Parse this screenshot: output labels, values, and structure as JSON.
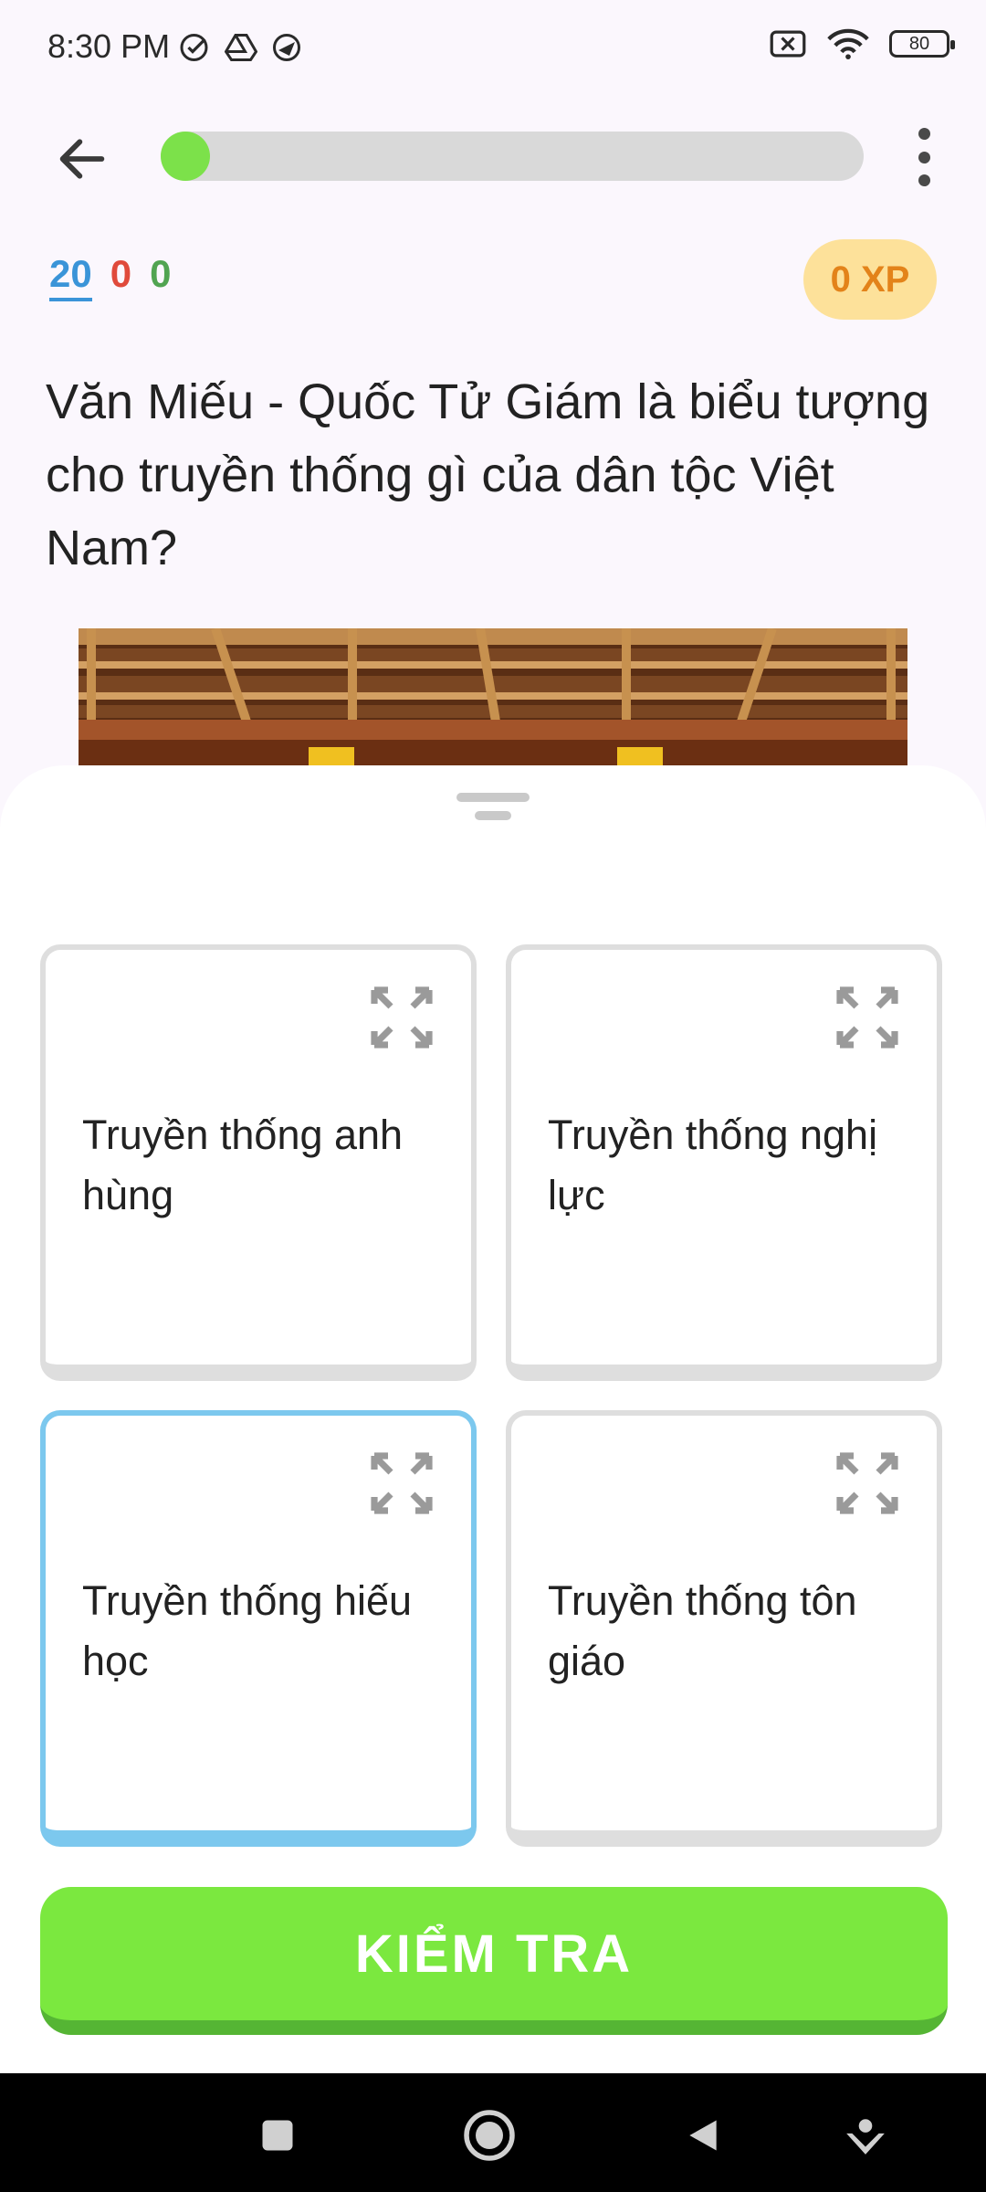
{
  "status_bar": {
    "time": "8:30 PM",
    "battery": "80",
    "left_icons": [
      "check-circle-icon",
      "drive-icon",
      "chat-icon"
    ],
    "right_icons": [
      "no-sim-icon",
      "wifi-icon",
      "battery-icon"
    ]
  },
  "top_bar": {
    "back_icon": "arrow-left-icon",
    "progress": 0.04,
    "progress_color": "#7ce14a",
    "menu_icon": "more-vertical-icon"
  },
  "stats": {
    "total": "20",
    "wrong": "0",
    "correct": "0",
    "xp": "0 XP"
  },
  "question": {
    "text": "Văn Miếu - Quốc Tử Giám là biểu tượng cho truyền thống gì của dân tộc Việt Nam?"
  },
  "options": [
    {
      "label": "Truyền thống anh hùng",
      "selected": false
    },
    {
      "label": "Truyền thống nghị lực",
      "selected": false
    },
    {
      "label": "Truyền thống hiếu học",
      "selected": true
    },
    {
      "label": "Truyền thống tôn giáo",
      "selected": false
    }
  ],
  "check_button": {
    "label": "KIỂM TRA",
    "color": "#7be83f"
  },
  "nav_bar": {
    "items": [
      "square-icon",
      "home-circle-icon",
      "back-triangle-icon",
      "assist-icon"
    ]
  }
}
